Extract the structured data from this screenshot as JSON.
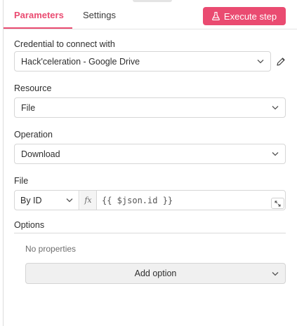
{
  "tabs": [
    {
      "label": "Parameters",
      "active": true
    },
    {
      "label": "Settings",
      "active": false
    }
  ],
  "execute_button": {
    "label": "Execute step",
    "icon": "flask-icon"
  },
  "credential": {
    "label": "Credential to connect with",
    "value": "Hack'celeration - Google Drive"
  },
  "resource": {
    "label": "Resource",
    "value": "File"
  },
  "operation": {
    "label": "Operation",
    "value": "Download"
  },
  "file": {
    "label": "File",
    "mode": "By ID",
    "fx_label": "fx",
    "expression": "{{ $json.id }}"
  },
  "options": {
    "label": "Options",
    "empty_text": "No properties",
    "add_label": "Add option"
  },
  "colors": {
    "accent": "#ea4b71",
    "border": "#d6d6d6"
  }
}
